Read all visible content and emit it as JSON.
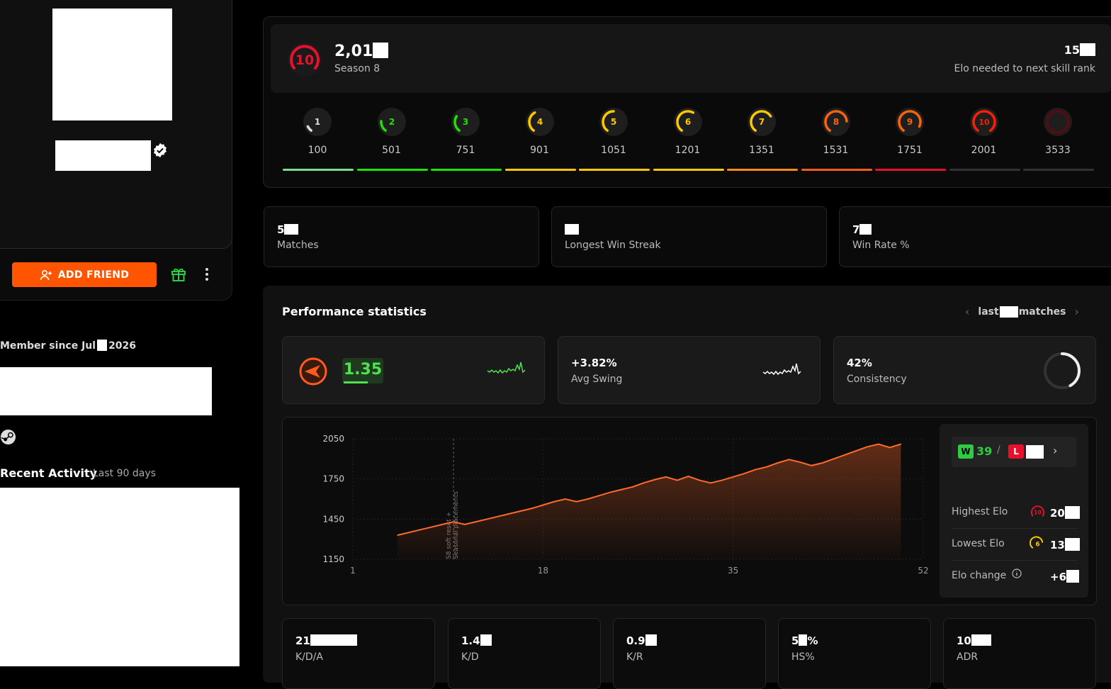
{
  "profile": {
    "add_friend_label": "ADD FRIEND",
    "member_since_prefix": "Member since Jul",
    "member_since_year": "2026",
    "recent_title": "Recent Activity",
    "recent_sub": "Last 90 days"
  },
  "elo": {
    "level": "10",
    "value_prefix": "2,01",
    "season": "Season 8",
    "needed_prefix": "15",
    "needed_label": "Elo needed to next skill rank"
  },
  "levels": [
    {
      "level": "1",
      "elo": "100",
      "color": "#dddddd",
      "bar": "#7ddc8a"
    },
    {
      "level": "2",
      "elo": "501",
      "color": "#1ce400",
      "bar": "#1ce400"
    },
    {
      "level": "3",
      "elo": "751",
      "color": "#1ce400",
      "bar": "#1ce400"
    },
    {
      "level": "4",
      "elo": "901",
      "color": "#ffc800",
      "bar": "#ffc800"
    },
    {
      "level": "5",
      "elo": "1051",
      "color": "#ffc800",
      "bar": "#ffc800"
    },
    {
      "level": "6",
      "elo": "1201",
      "color": "#ffc800",
      "bar": "#ffc800"
    },
    {
      "level": "7",
      "elo": "1351",
      "color": "#ffc800",
      "bar": "#ff8c1a"
    },
    {
      "level": "8",
      "elo": "1531",
      "color": "#ff6309",
      "bar": "#ff5a1f"
    },
    {
      "level": "9",
      "elo": "1751",
      "color": "#ff6309",
      "bar": "#e8112d"
    },
    {
      "level": "10",
      "elo": "2001",
      "color": "#fe1f00",
      "bar": "#333333"
    },
    {
      "level": "",
      "elo": "3533",
      "color": "#5a0a10",
      "bar": "#333333"
    }
  ],
  "stats": {
    "matches_prefix": "5",
    "matches_label": "Matches",
    "streak_label": "Longest Win Streak",
    "winrate_prefix": "7",
    "winrate_label": "Win Rate %"
  },
  "performance": {
    "title": "Performance statistics",
    "last_label": "last",
    "matches_label": "matches",
    "kd_value": "1.35",
    "swing_value": "+3.82%",
    "swing_label": "Avg Swing",
    "consistency_value": "42%",
    "consistency_label": "Consistency",
    "consistency_level": 0.42
  },
  "chart_data": {
    "type": "area",
    "x": [
      5,
      6,
      7,
      8,
      9,
      10,
      11,
      12,
      13,
      14,
      15,
      16,
      17,
      18,
      19,
      20,
      21,
      22,
      23,
      24,
      25,
      26,
      27,
      28,
      29,
      30,
      31,
      32,
      33,
      34,
      35,
      36,
      37,
      38,
      39,
      40,
      41,
      42,
      43,
      44,
      45,
      46,
      47,
      48,
      49,
      50
    ],
    "values": [
      1330,
      1350,
      1370,
      1390,
      1410,
      1430,
      1410,
      1430,
      1450,
      1470,
      1490,
      1510,
      1530,
      1555,
      1580,
      1600,
      1580,
      1600,
      1625,
      1650,
      1670,
      1690,
      1720,
      1745,
      1765,
      1740,
      1770,
      1740,
      1720,
      1740,
      1765,
      1790,
      1820,
      1840,
      1870,
      1895,
      1875,
      1850,
      1870,
      1900,
      1930,
      1960,
      1990,
      2010,
      1985,
      2010
    ],
    "ylim": [
      1150,
      2050
    ],
    "xlim": [
      1,
      52
    ],
    "yticks": [
      "2050",
      "1750",
      "1450",
      "1150"
    ],
    "xticks": [
      "1",
      "18",
      "35",
      "52"
    ],
    "annotation": "S8 soft reset + Seasonal placements",
    "annotation_x": 10,
    "line_color": "#ff6a2b"
  },
  "sidepanel": {
    "w_badge": "W",
    "w_value": "39",
    "separator": "/",
    "l_badge": "L",
    "highest_label": "Highest Elo",
    "highest_prefix": "20",
    "highest_level": "10",
    "lowest_label": "Lowest Elo",
    "lowest_prefix": "13",
    "lowest_level": "6",
    "change_label": "Elo change",
    "change_prefix": "+6"
  },
  "bottom": [
    {
      "prefix": "21",
      "label": "K/D/A"
    },
    {
      "prefix": "1.4",
      "label": "K/D"
    },
    {
      "prefix": "0.9",
      "label": "K/R"
    },
    {
      "prefix": "5",
      "suffix": "%",
      "label": "HS%"
    },
    {
      "prefix": "10",
      "label": "ADR"
    }
  ]
}
